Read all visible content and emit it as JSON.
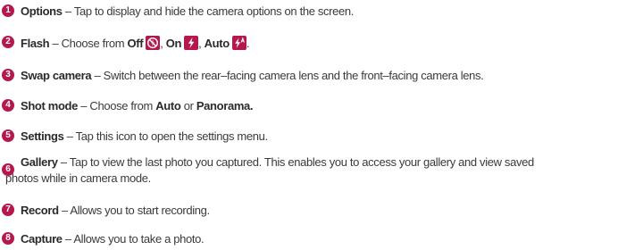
{
  "items": [
    {
      "num": "1",
      "term": "Options",
      "desc": " – Tap to display and hide the camera options on the screen."
    },
    {
      "num": "2",
      "term": "Flash",
      "desc_prefix": " – Choose from ",
      "opt_off": "Off",
      "sep1": ", ",
      "opt_on": "On",
      "sep2": ", ",
      "opt_auto": "Auto",
      "end": "."
    },
    {
      "num": "3",
      "term": "Swap camera",
      "desc": " – Switch between the rear–facing camera lens and the front–facing camera lens."
    },
    {
      "num": "4",
      "term": "Shot mode",
      "desc_prefix": " – Choose from ",
      "opt1": "Auto",
      "mid": " or ",
      "opt2": "Panorama."
    },
    {
      "num": "5",
      "term": "Settings",
      "desc": " – Tap this icon to open the settings menu."
    },
    {
      "num": "6",
      "term": "Gallery",
      "desc_line1": " – Tap to view the last photo you captured. This enables you to access your gallery and view saved",
      "desc_line2": "photos while in camera mode."
    },
    {
      "num": "7",
      "term": "Record",
      "desc": " – Allows you to start recording."
    },
    {
      "num": "8",
      "term": "Capture",
      "desc": " – Allows you to take a photo."
    }
  ],
  "icons": {
    "flash_off": "flash-off-icon",
    "flash_on": "flash-on-icon",
    "flash_auto": "flash-auto-icon"
  },
  "colors": {
    "bullet": "#b5184d",
    "text": "#3a3a3a"
  }
}
